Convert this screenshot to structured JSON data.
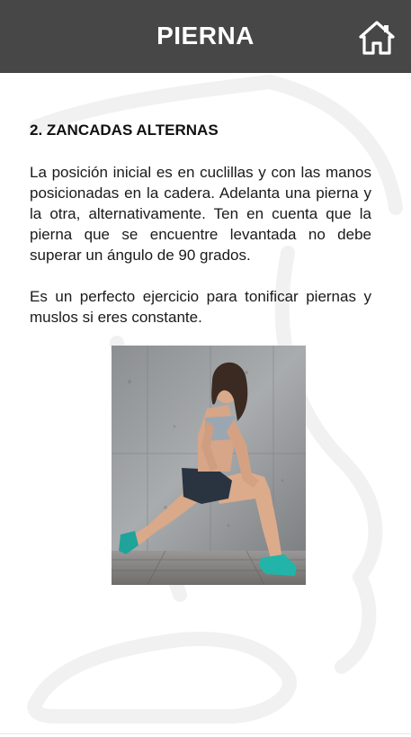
{
  "header": {
    "title": "PIERNA",
    "home_icon": "home-icon",
    "background_color": "#474747",
    "text_color": "#ffffff"
  },
  "exercise": {
    "title": "2. ZANCADAS ALTERNAS",
    "paragraphs": [
      "La posición inicial es en cuclillas y con las manos posicionadas en la cadera. Adelanta una pierna y la otra, alternativamente. Ten en cuenta que la pierna que se encuentre levantada no debe superar un ángulo de 90 grados.",
      "Es un perfecto ejercicio para tonificar piernas y muslos si eres constante."
    ],
    "image": "woman-doing-lunge-photo"
  }
}
